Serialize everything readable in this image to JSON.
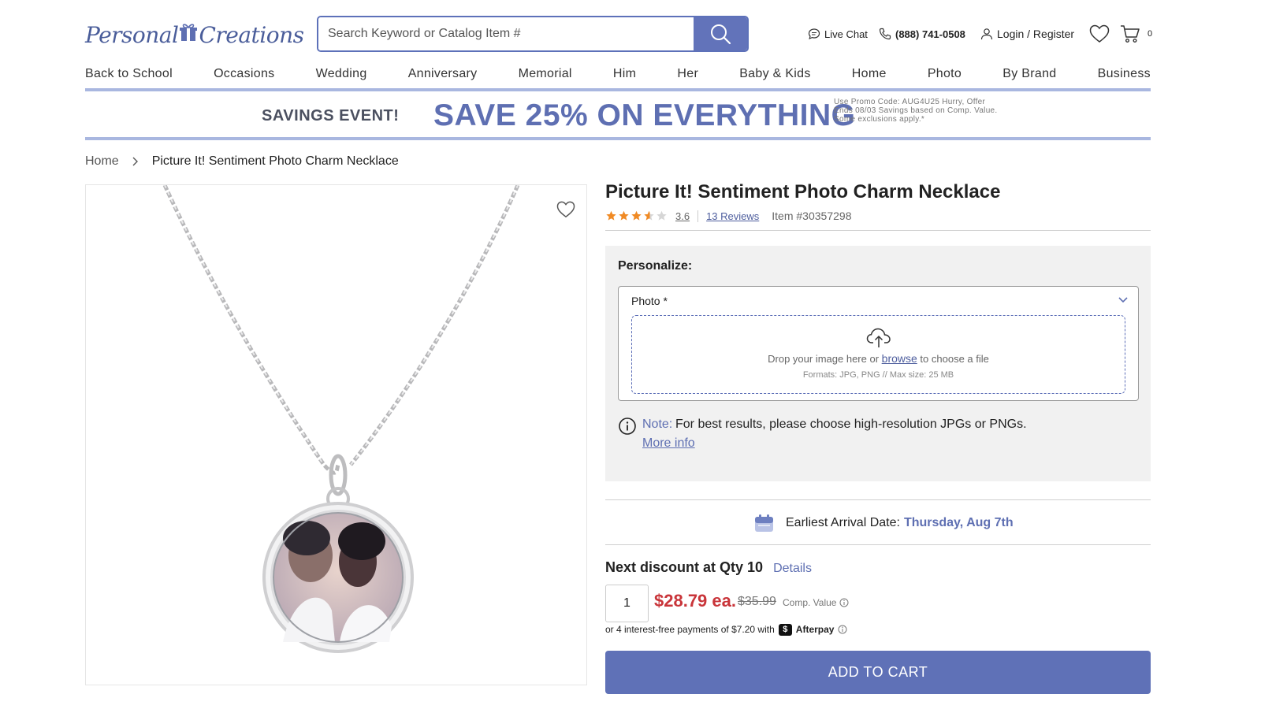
{
  "brand": {
    "name": "PersonalCreations",
    "accent": "#5e6fb2",
    "sale_color": "#c9353a",
    "button_color": "#5f71b7"
  },
  "search": {
    "placeholder": "Search Keyword or Catalog Item #",
    "value": ""
  },
  "header": {
    "live_chat": "Live Chat",
    "phone": "(888) 741-0508",
    "login": "Login / Register",
    "cart_count": "0"
  },
  "nav": [
    "Back to School",
    "Occasions",
    "Wedding",
    "Anniversary",
    "Memorial",
    "Him",
    "Her",
    "Baby & Kids",
    "Home",
    "Photo",
    "By Brand",
    "Business"
  ],
  "banner": {
    "left": "SAVINGS EVENT!",
    "main": "SAVE 25% ON EVERYTHING",
    "fine_print": "Use Promo Code: AUG4U25 Hurry, Offer Ends 08/03 Savings based on Comp. Value. Some exclusions apply.*"
  },
  "breadcrumb": {
    "home": "Home",
    "current": "Picture It! Sentiment Photo Charm Necklace"
  },
  "product": {
    "title": "Picture It! Sentiment Photo Charm Necklace",
    "rating": 3.6,
    "rating_text": "3.6",
    "reviews": "13 Reviews",
    "item_number": "Item #30357298"
  },
  "personalize": {
    "label": "Personalize:",
    "photo_label": "Photo *",
    "drop_text_before": "Drop your image here or",
    "browse": "browse",
    "drop_text_after": "to choose a file",
    "formats": "Formats: JPG, PNG // Max size: 25 MB",
    "note_label": "Note:",
    "note_text": "For best results, please choose high-resolution JPGs or PNGs.",
    "more_info": "More info"
  },
  "delivery": {
    "label": "Earliest Arrival Date:",
    "date": "Thursday, Aug 7th"
  },
  "pricing": {
    "next_discount": "Next discount at Qty 10",
    "details": "Details",
    "qty": "1",
    "price": "$28.79 ea.",
    "comp_price": "$35.99",
    "comp_label": "Comp. Value",
    "afterpay_text": "or 4 interest-free payments of $7.20 with",
    "afterpay_name": "Afterpay"
  },
  "cta": {
    "add_to_cart": "ADD TO CART"
  },
  "icons": [
    "gift-icon",
    "search-icon",
    "chat-icon",
    "phone-icon",
    "user-icon",
    "heart-icon",
    "cart-icon",
    "chevron-right-icon",
    "star-icon",
    "chevron-down-icon",
    "cloud-upload-icon",
    "info-icon",
    "calendar-icon"
  ]
}
